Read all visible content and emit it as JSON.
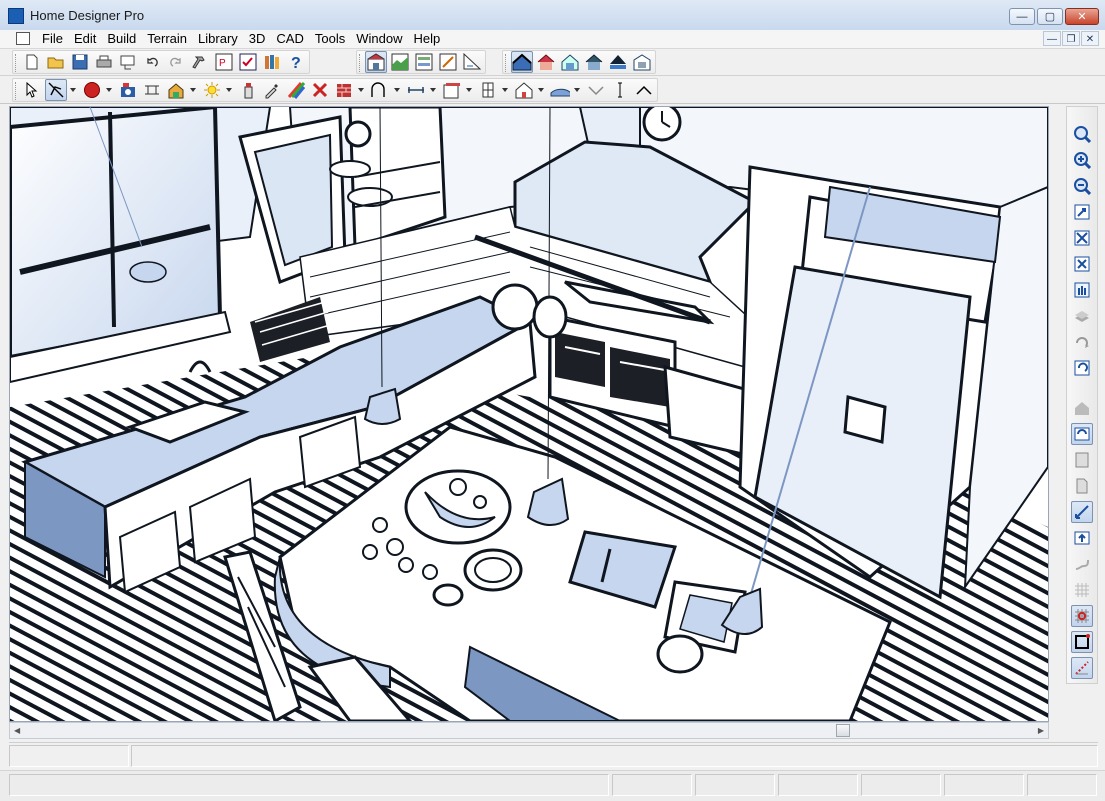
{
  "window": {
    "title": "Home Designer Pro",
    "app_icon": "home-designer-app-icon",
    "minimize_icon": "minimize-icon",
    "maximize_icon": "maximize-icon",
    "close_icon": "close-icon"
  },
  "menu": {
    "items": [
      "File",
      "Edit",
      "Build",
      "Terrain",
      "Library",
      "3D",
      "CAD",
      "Tools",
      "Window",
      "Help"
    ]
  },
  "toolbar_top": {
    "group1": [
      "new-file-icon",
      "open-folder-icon",
      "save-icon",
      "print-icon",
      "print-preview-icon",
      "undo-icon",
      "redo-icon",
      "hammer-icon",
      "plan-layout-icon",
      "checklist-icon",
      "library-books-icon",
      "help-icon"
    ],
    "group2": [
      "floor-plan-view-icon",
      "terrain-view-icon",
      "elevation-view-icon",
      "layout-view-icon",
      "cad-view-icon"
    ],
    "group3": [
      "full-camera-icon",
      "exterior-house-icon",
      "cross-section-icon",
      "perspective-house-icon",
      "roof-overview-icon",
      "materials-list-icon"
    ]
  },
  "toolbar_bottom": {
    "tools": [
      "select-arrow-icon",
      "edit-tool-icon",
      "circle-object-icon",
      "camera-icon",
      "dimension-icon",
      "image-insert-icon",
      "sun-light-icon",
      "paint-sprayer-icon",
      "eyedropper-icon",
      "material-palette-icon",
      "delete-object-icon",
      "brick-wall-icon",
      "arc-line-icon",
      "measure-icon",
      "cabinet-icon",
      "window-icon",
      "house-icon",
      "terrain-icon",
      "chevron-down-icon",
      "cursor-line-icon",
      "chevron-up-icon"
    ]
  },
  "sidebar": {
    "tools": [
      "zoom-icon",
      "zoom-in-icon",
      "zoom-out-icon",
      "zoom-box-icon",
      "fill-window-icon",
      "fit-screen-icon",
      "pan-hand-icon",
      "layer-icon",
      "rotate-icon",
      "undo-view-icon",
      "house-view-icon",
      "refresh-view-icon",
      "page-icon",
      "document-icon",
      "line-tool-icon",
      "up-arrow-icon",
      "spring-icon",
      "grid-icon",
      "snap-grid-icon",
      "snap-point-icon",
      "snap-angle-icon"
    ]
  },
  "colors": {
    "accent": "#1a5fb4",
    "line": "#0f1620",
    "fill": "#c6d6ee",
    "deep": "#7d97c3",
    "window_bg": "#f0f0f0"
  }
}
